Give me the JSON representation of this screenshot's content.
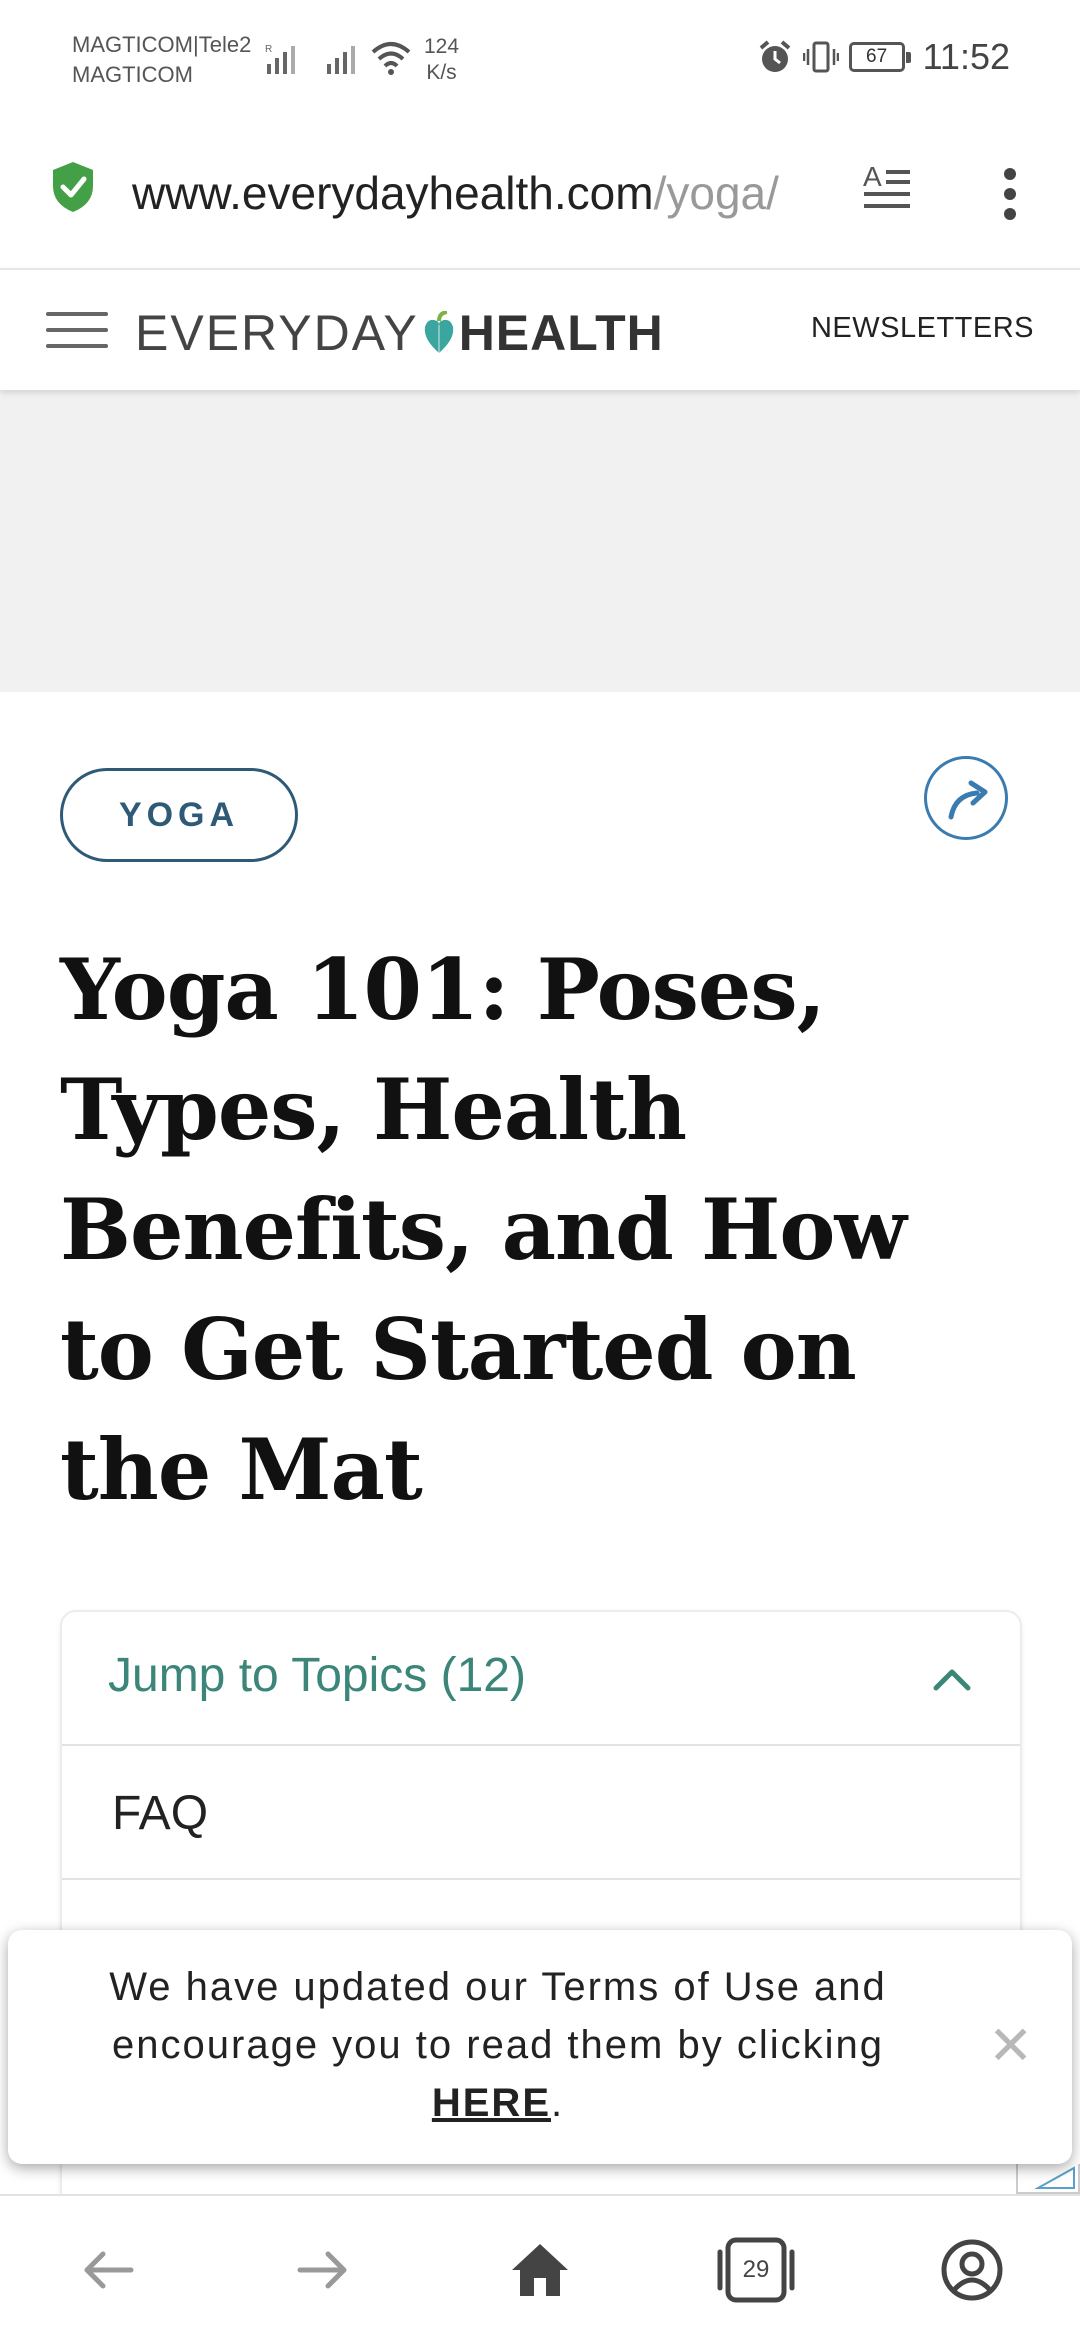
{
  "status_bar": {
    "carrier_top": "MAGTICOM|Tele2",
    "carrier_bottom": "MAGTICOM",
    "net_speed_value": "124",
    "net_speed_unit": "K/s",
    "battery": "67",
    "time": "11:52"
  },
  "address_bar": {
    "url_domain": "www.everydayhealth.com",
    "url_path": "/yoga/"
  },
  "site_header": {
    "logo_left": "EVERYDAY",
    "logo_right": "HEALTH",
    "newsletters_label": "NEWSLETTERS"
  },
  "article": {
    "tag": "YOGA",
    "title": "Yoga 101: Poses, Types, Health Benefits, and How to Get Started on the Mat"
  },
  "toc": {
    "header": "Jump to Topics (12)",
    "items": [
      {
        "label": "FAQ"
      }
    ]
  },
  "terms_toast": {
    "text": "We have updated our Terms of Use and encourage you to read them by clicking",
    "link": "HERE",
    "suffix": ".",
    "close": "✕"
  },
  "bottom_nav": {
    "tabs_count": "29"
  },
  "colors": {
    "teal": "#3b8579",
    "tag_blue": "#2e5a78",
    "share_blue": "#3a7bb0",
    "shield_green": "#43a047"
  }
}
